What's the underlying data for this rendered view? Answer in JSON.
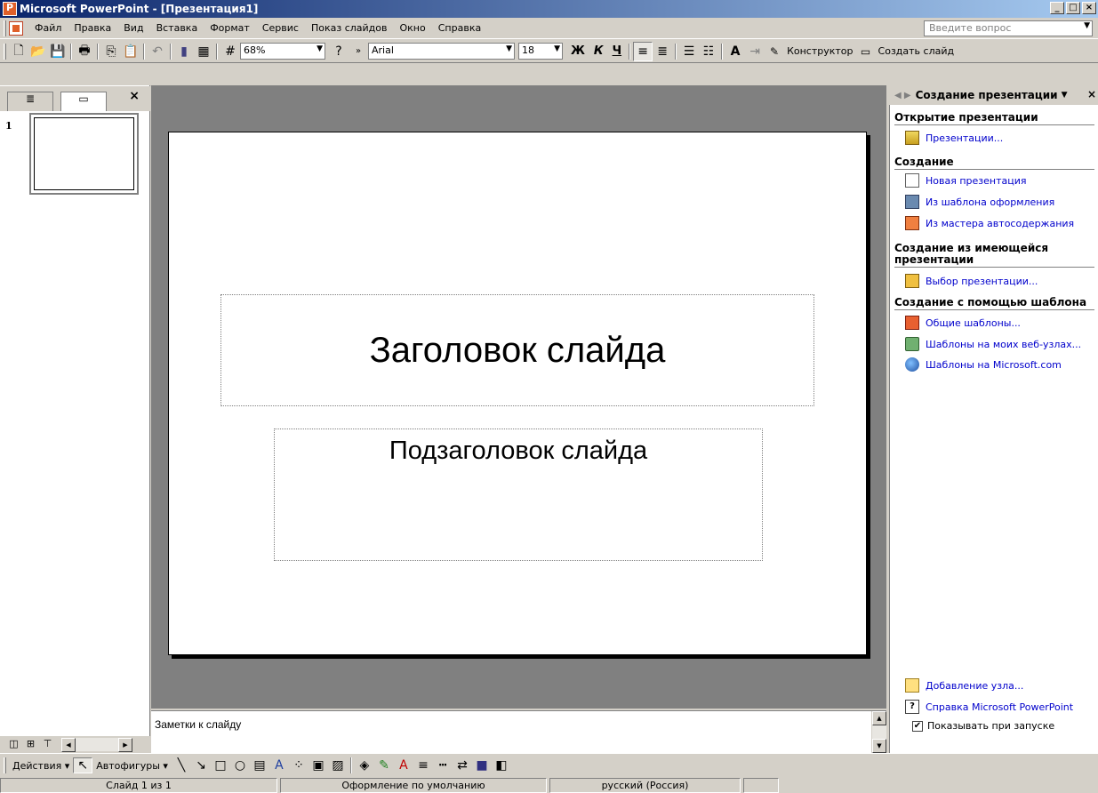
{
  "window": {
    "title": "Microsoft PowerPoint - [Презентация1]",
    "buttons": {
      "minimize": "_",
      "maximize": "□",
      "close": "×"
    }
  },
  "menu": {
    "items": [
      "Файл",
      "Правка",
      "Вид",
      "Вставка",
      "Формат",
      "Сервис",
      "Показ слайдов",
      "Окно",
      "Справка"
    ],
    "help_placeholder": "Введите вопрос"
  },
  "toolbar": {
    "zoom": "68%",
    "font": "Arial",
    "font_size": "18",
    "bold": "Ж",
    "italic": "К",
    "underline": "Ч",
    "designer_label": "Конструктор",
    "new_slide_label": "Создать слайд"
  },
  "outline": {
    "slide_number": "1"
  },
  "slide": {
    "title": "Заголовок слайда",
    "subtitle": "Подзаголовок слайда"
  },
  "notes": {
    "placeholder": "Заметки к слайду"
  },
  "task_pane": {
    "title": "Создание презентации",
    "sections": {
      "open": "Открытие презентации",
      "create": "Создание",
      "from_existing_line1": "Создание из имеющейся",
      "from_existing_line2": "презентации",
      "from_template": "Создание с помощью шаблона"
    },
    "links": {
      "presentations": "Презентации...",
      "new_presentation": "Новая презентация",
      "from_design_template": "Из шаблона оформления",
      "from_autocontent": "Из мастера автосодержания",
      "choose_presentation": "Выбор презентации...",
      "general_templates": "Общие шаблоны...",
      "templates_on_my_sites": "Шаблоны на моих веб-узлах...",
      "templates_on_microsoft": "Шаблоны на Microsoft.com",
      "add_node": "Добавление узла...",
      "help": "Справка Microsoft PowerPoint"
    },
    "show_at_startup": "Показывать при запуске"
  },
  "drawing": {
    "actions": "Действия",
    "autoshapes": "Автофигуры"
  },
  "status": {
    "slide": "Слайд 1 из 1",
    "design": "Оформление по умолчанию",
    "language": "русский (Россия)"
  },
  "colors": {
    "titlebar_start": "#0a246a",
    "link": "#0000cc",
    "workspace": "#808080"
  }
}
